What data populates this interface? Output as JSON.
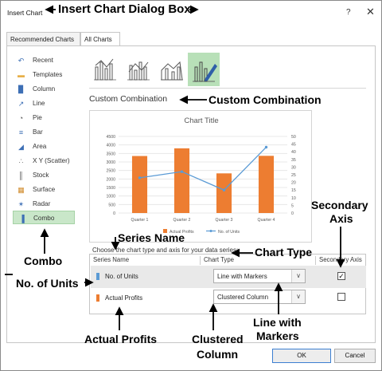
{
  "window": {
    "title": "Insert Chart",
    "help_label": "?",
    "close_label": "✕"
  },
  "tabs": [
    {
      "label": "Recommended Charts"
    },
    {
      "label": "All Charts"
    }
  ],
  "sidebar": {
    "items": [
      {
        "label": "Recent",
        "icon": "recent-icon",
        "glyph": "↶"
      },
      {
        "label": "Templates",
        "icon": "templates-icon",
        "glyph": "▬"
      },
      {
        "label": "Column",
        "icon": "column-chart-icon",
        "glyph": "▉"
      },
      {
        "label": "Line",
        "icon": "line-chart-icon",
        "glyph": "↗"
      },
      {
        "label": "Pie",
        "icon": "pie-chart-icon",
        "glyph": "◔"
      },
      {
        "label": "Bar",
        "icon": "bar-chart-icon",
        "glyph": "≡"
      },
      {
        "label": "Area",
        "icon": "area-chart-icon",
        "glyph": "◢"
      },
      {
        "label": "X Y (Scatter)",
        "icon": "scatter-chart-icon",
        "glyph": "∴"
      },
      {
        "label": "Stock",
        "icon": "stock-chart-icon",
        "glyph": "║"
      },
      {
        "label": "Surface",
        "icon": "surface-chart-icon",
        "glyph": "▦"
      },
      {
        "label": "Radar",
        "icon": "radar-chart-icon",
        "glyph": "✴"
      },
      {
        "label": "Combo",
        "icon": "combo-chart-icon",
        "glyph": "▐"
      }
    ],
    "selected_index": 11
  },
  "combo_section": {
    "title": "Custom Combination",
    "prompt": "Choose the chart type and axis for your data series:"
  },
  "series_grid": {
    "headers": {
      "series_name": "Series Name",
      "chart_type": "Chart Type",
      "secondary_axis": "Secondary Axis"
    },
    "rows": [
      {
        "name": "No. of Units",
        "color": "#5b9bd5",
        "chart_type": "Line with Markers",
        "secondary_axis": true
      },
      {
        "name": "Actual Profits",
        "color": "#ed7d31",
        "chart_type": "Clustered Column",
        "secondary_axis": false
      }
    ]
  },
  "buttons": {
    "ok": "OK",
    "cancel": "Cancel"
  },
  "checkmark": "✓",
  "dropdown_arrow": "∨",
  "chart_data": {
    "type": "bar",
    "title": "Chart Title",
    "categories": [
      "Quarter 1",
      "Quarter 2",
      "Quarter 3",
      "Quarter 4"
    ],
    "y_ticks": [
      "0",
      "500",
      "1000",
      "1500",
      "2000",
      "2500",
      "3000",
      "3500",
      "4000",
      "4500"
    ],
    "y2_ticks": [
      "0",
      "5",
      "10",
      "15",
      "20",
      "25",
      "30",
      "35",
      "40",
      "45",
      "50"
    ],
    "ylim": [
      0,
      4500
    ],
    "y2lim": [
      0,
      50
    ],
    "series": [
      {
        "name": "Actual Profits",
        "type": "bar",
        "axis": "primary",
        "color": "#ed7d31",
        "values": [
          3350,
          3800,
          2330,
          3360
        ]
      },
      {
        "name": "No. of Units",
        "type": "line",
        "axis": "secondary",
        "color": "#5b9bd5",
        "values": [
          23,
          27,
          15,
          43
        ]
      }
    ],
    "legend": "bottom",
    "grid": true
  },
  "annotations": {
    "dialog_box": "Insert Chart Dialog Box",
    "custom_combination": "Custom Combination",
    "series_name": "Series Name",
    "chart_type": "Chart Type",
    "secondary_axis_1": "Secondary",
    "secondary_axis_2": "Axis",
    "combo": "Combo",
    "no_of_units": "No. of Units",
    "line_with_1": "Line with",
    "line_with_2": "Markers",
    "actual_profits": "Actual Profits",
    "clustered_1": "Clustered",
    "clustered_2": "Column"
  }
}
